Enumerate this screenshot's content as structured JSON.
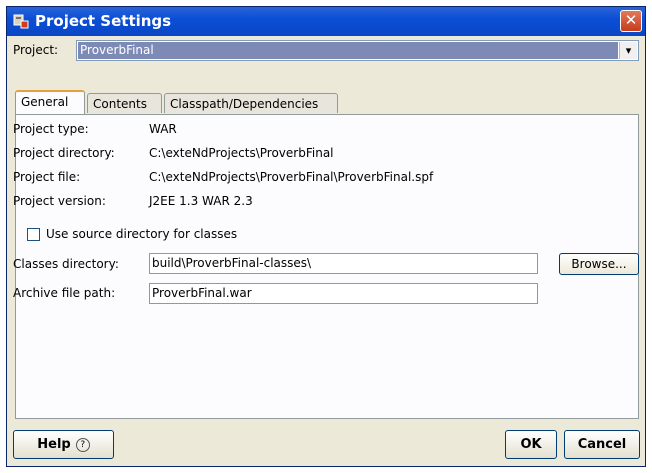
{
  "window": {
    "title": "Project Settings",
    "close_glyph": "✕"
  },
  "project": {
    "label": "Project:",
    "value": "ProverbFinal"
  },
  "tabs": [
    {
      "label": "General",
      "active": true
    },
    {
      "label": "Contents",
      "active": false
    },
    {
      "label": "Classpath/Dependencies",
      "active": false
    }
  ],
  "general": {
    "project_type_label": "Project type:",
    "project_type_value": "WAR",
    "project_directory_label": "Project directory:",
    "project_directory_value": "C:\\exteNdProjects\\ProverbFinal",
    "project_file_label": "Project file:",
    "project_file_value": "C:\\exteNdProjects\\ProverbFinal\\ProverbFinal.spf",
    "project_version_label": "Project version:",
    "project_version_value": "J2EE 1.3 WAR 2.3",
    "use_source_checkbox_label": "Use source directory for classes",
    "use_source_checked": false,
    "classes_directory_label": "Classes directory:",
    "classes_directory_value": "build\\ProverbFinal-classes\\",
    "browse_label": "Browse...",
    "archive_path_label": "Archive file path:",
    "archive_path_value": "ProverbFinal.war"
  },
  "buttons": {
    "help": "Help",
    "help_glyph": "?",
    "ok": "OK",
    "cancel": "Cancel"
  }
}
